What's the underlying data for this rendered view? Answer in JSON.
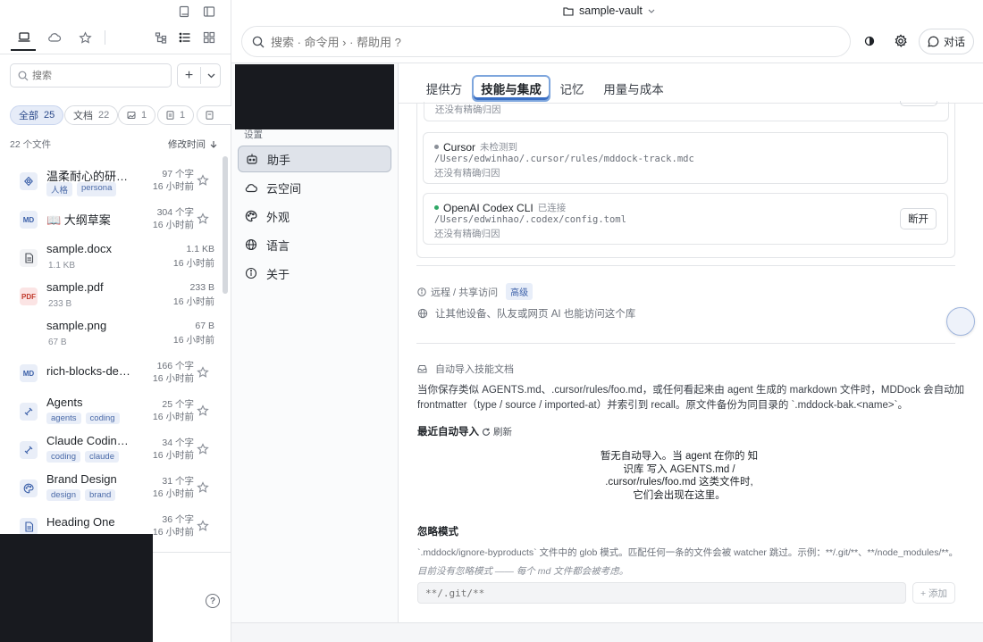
{
  "vault": {
    "name": "sample-vault"
  },
  "sidebar": {
    "search_placeholder": "搜索",
    "filters": [
      {
        "label": "全部",
        "count": "25"
      },
      {
        "label": "文档",
        "count": "22"
      },
      {
        "label": "",
        "count": "1"
      },
      {
        "label": "",
        "count": "1"
      },
      {
        "label": "",
        "count": ""
      }
    ],
    "file_count": "22 个文件",
    "sort_label": "修改时间",
    "files": [
      {
        "name": "温柔耐心的研究…",
        "size": "97 个字",
        "time": "16 小时前",
        "icon": "persona-icon",
        "tags": [
          "人格",
          "persona"
        ]
      },
      {
        "name": "📖 大纲草案",
        "size": "304 个字",
        "time": "16 小时前",
        "icon": "md-icon",
        "tags": []
      },
      {
        "name": "sample.docx",
        "size": "1.1 KB",
        "time": "16 小时前",
        "icon": "doc-icon",
        "sub": "1.1 KB",
        "tags": []
      },
      {
        "name": "sample.pdf",
        "size": "233 B",
        "time": "16 小时前",
        "icon": "pdf-icon",
        "sub": "233 B",
        "tags": []
      },
      {
        "name": "sample.png",
        "size": "67 B",
        "time": "16 小时前",
        "icon": "",
        "sub": "67 B",
        "tags": []
      },
      {
        "name": "rich-blocks-de…",
        "size": "166 个字",
        "time": "16 小时前",
        "icon": "md-icon",
        "tags": []
      },
      {
        "name": "Agents",
        "size": "25 个字",
        "time": "16 小时前",
        "icon": "skill-icon",
        "tags": [
          "agents",
          "coding"
        ]
      },
      {
        "name": "Claude Coding …",
        "size": "34 个字",
        "time": "16 小时前",
        "icon": "skill-icon",
        "tags": [
          "coding",
          "claude"
        ]
      },
      {
        "name": "Brand Design",
        "size": "31 个字",
        "time": "16 小时前",
        "icon": "palette-icon",
        "tags": [
          "design",
          "brand"
        ]
      },
      {
        "name": "Heading One",
        "size": "36 个字",
        "time": "16 小时前",
        "icon": "doc-icon",
        "tags": []
      }
    ]
  },
  "topbar": {
    "search_placeholder": "搜索 · 命令用 › · 帮助用 ?",
    "chat_label": "对话"
  },
  "settings_nav": {
    "heading": "设置",
    "items": [
      {
        "label": "助手",
        "icon": "bot-icon"
      },
      {
        "label": "云空间",
        "icon": "cloud-icon"
      },
      {
        "label": "外观",
        "icon": "palette-icon"
      },
      {
        "label": "语言",
        "icon": "globe-icon"
      },
      {
        "label": "关于",
        "icon": "info-icon"
      }
    ]
  },
  "tabs": [
    "提供方",
    "技能与集成",
    "记忆",
    "用量与成本"
  ],
  "integrations": {
    "partial_note": "还没有精确归因",
    "cursor": {
      "name": "Cursor",
      "status": "未检测到",
      "path": "/Users/edwinhao/.cursor/rules/mddock-track.mdc",
      "note": "还没有精确归因"
    },
    "codex": {
      "name": "OpenAI Codex CLI",
      "status": "已连接",
      "path": "/Users/edwinhao/.codex/config.toml",
      "note": "还没有精确归因",
      "action": "断开"
    }
  },
  "remote": {
    "title": "远程 / 共享访问",
    "badge": "高级",
    "desc": "让其他设备、队友或网页 AI 也能访问这个库"
  },
  "auto_import": {
    "title": "自动导入技能文档",
    "desc_line1": "当你保存类似 AGENTS.md、.cursor/rules/foo.md，或任何看起来由 agent 生成的 markdown 文件时，MDDock 会自动加",
    "desc_line2": "frontmatter（type / source / imported-at）并索引到 recall。原文件备份为同目录的 `.mddock-bak.<name>`。",
    "recent_label": "最近自动导入",
    "refresh_label": "刷新",
    "empty_lines": [
      "暂无自动导入。当 agent 在你的 知",
      "识库 写入 AGENTS.md /",
      ".cursor/rules/foo.md 这类文件时,",
      "它们会出现在这里。"
    ]
  },
  "ignore": {
    "title": "忽略模式",
    "desc": "`.mddock/ignore-byproducts` 文件中的 glob 模式。匹配任何一条的文件会被 watcher 跳过。示例：**/.git/**、**/node_modules/**。",
    "empty": "目前没有忽略模式 —— 每个 md 文件都会被考虑。",
    "input_placeholder": "**/.git/**",
    "add_label": "+ 添加"
  }
}
